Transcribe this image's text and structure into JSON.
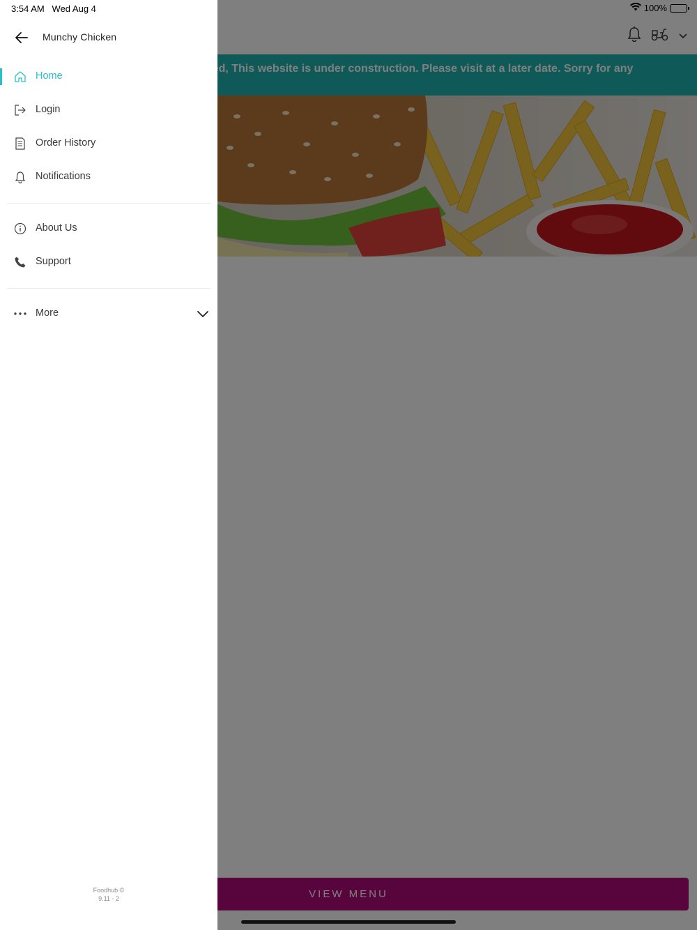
{
  "status_bar": {
    "time": "3:54 AM",
    "date": "Wed Aug 4",
    "battery": "100%"
  },
  "drawer": {
    "title": "Munchy Chicken",
    "primary_items": [
      {
        "label": "Home",
        "icon": "home-icon",
        "active": true
      },
      {
        "label": "Login",
        "icon": "login-icon",
        "active": false
      },
      {
        "label": "Order History",
        "icon": "receipt-icon",
        "active": false
      },
      {
        "label": "Notifications",
        "icon": "bell-icon",
        "active": false
      }
    ],
    "secondary_items": [
      {
        "label": "About Us",
        "icon": "info-icon"
      },
      {
        "label": "Support",
        "icon": "phone-icon"
      }
    ],
    "more": {
      "label": "More",
      "icon": "more-dots-icon"
    },
    "footer_line1": "Foodhub ©",
    "footer_line2": "9.11 - 2"
  },
  "banner": {
    "text": "osed, This website is under construction. Please visit at a later date. Sorry for any"
  },
  "view_menu_label": "VIEW MENU",
  "colors": {
    "accent": "#24c2cd",
    "banner": "#1fb5b3",
    "button": "#b30a7a"
  }
}
